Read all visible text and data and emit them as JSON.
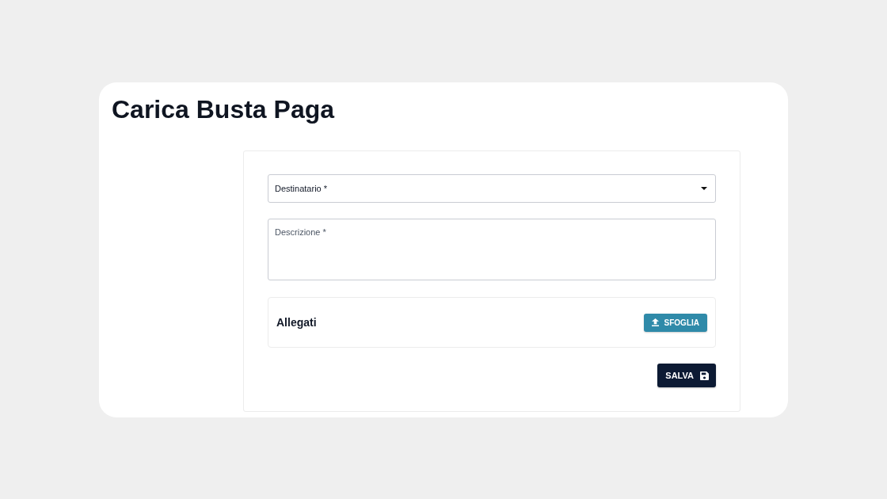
{
  "page": {
    "title": "Carica Busta Paga"
  },
  "form": {
    "recipient": {
      "label": "Destinatario *"
    },
    "description": {
      "placeholder": "Descrizione *"
    },
    "attachments": {
      "title": "Allegati",
      "browse_button": "SFOGLIA"
    },
    "save_button": "SALVA"
  }
}
